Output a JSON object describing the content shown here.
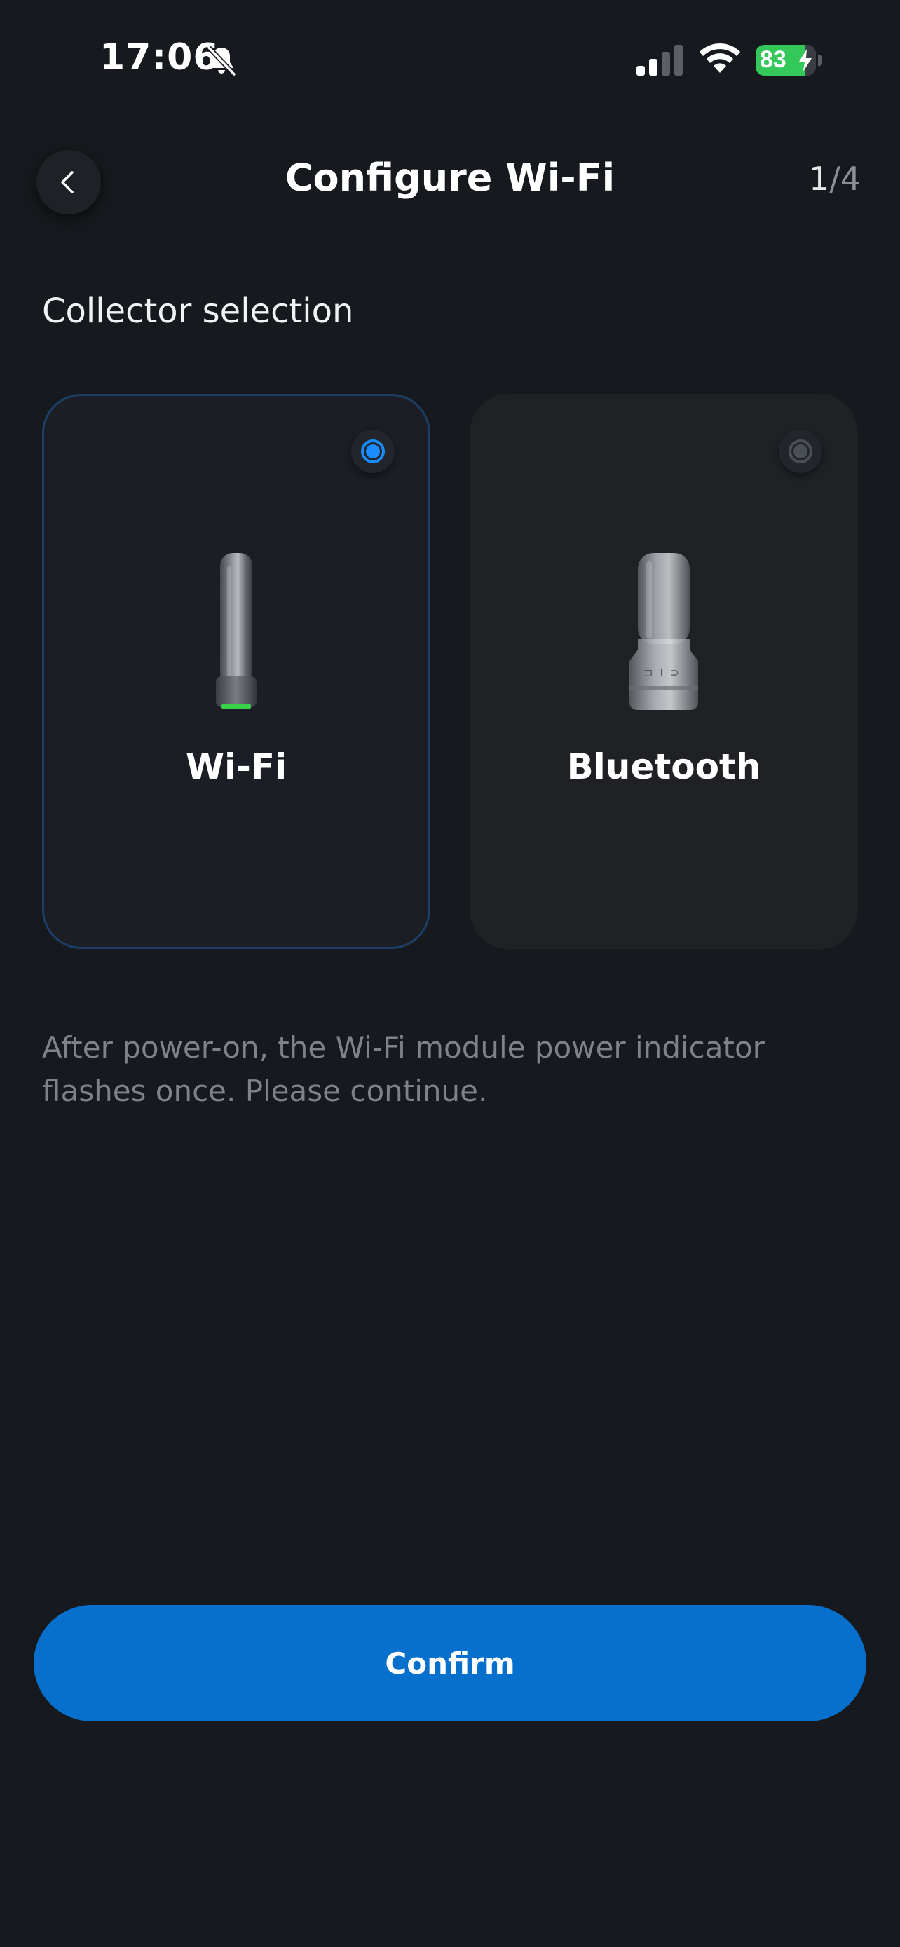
{
  "status_bar": {
    "time": "17:06",
    "battery_percent": "83",
    "battery_level": 0.83,
    "icons": [
      "bell-off-icon",
      "signal-icon",
      "wifi-icon",
      "battery-charging-icon"
    ]
  },
  "nav": {
    "title": "Configure Wi-Fi",
    "step_current": "1",
    "step_separator": "/",
    "step_total": "4",
    "back_icon": "chevron-left-icon"
  },
  "section": {
    "label": "Collector selection"
  },
  "options": [
    {
      "label": "Wi-Fi",
      "selected": true,
      "icon": "wifi-collector-device"
    },
    {
      "label": "Bluetooth",
      "selected": false,
      "icon": "bluetooth-collector-device"
    }
  ],
  "hint": "After power-on, the Wi-Fi module power indicator flashes once. Please continue.",
  "confirm_label": "Confirm",
  "colors": {
    "background": "#16191d",
    "accent": "#1a8cff",
    "button": "#0670cc",
    "battery_green": "#34c759"
  }
}
